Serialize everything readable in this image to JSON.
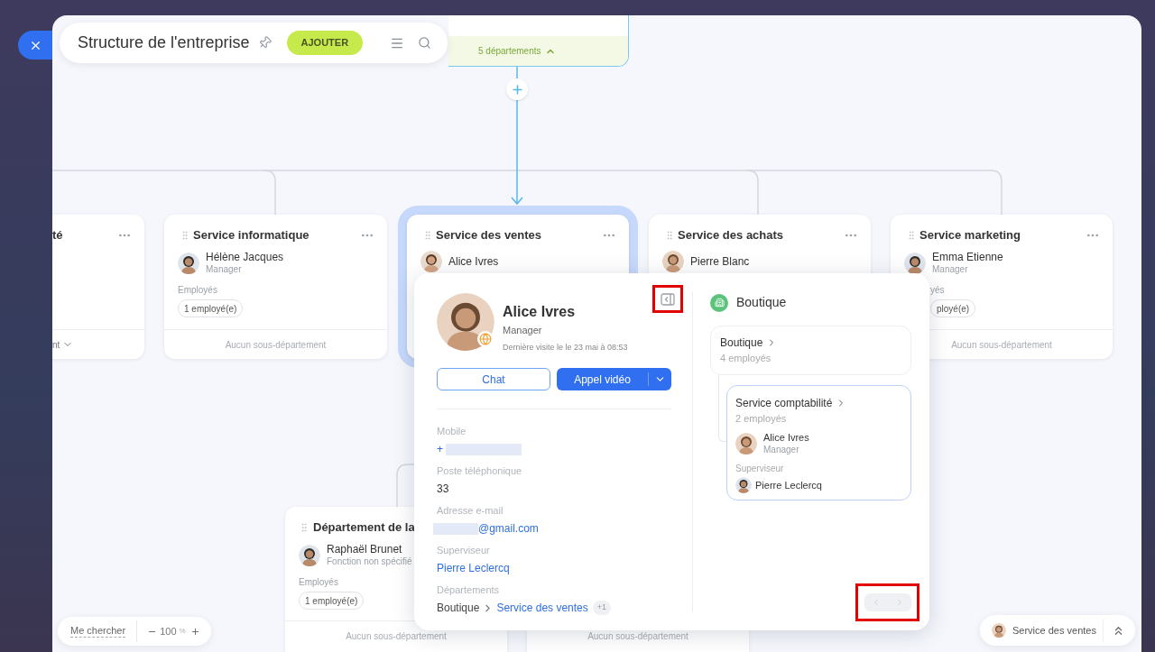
{
  "header": {
    "title": "Structure de l'entreprise",
    "add_button": "AJOUTER"
  },
  "root_node": {
    "footer": "5 départements",
    "expanded": true
  },
  "departments": [
    {
      "kind": "cut_left",
      "title": "té",
      "footer": "nt",
      "expanded": false,
      "selected": false
    },
    {
      "kind": "full",
      "title": "Service informatique",
      "head": {
        "name": "Hélène Jacques",
        "role": "Manager"
      },
      "employees_label": "Employés",
      "employees": "1 employé(e)",
      "footer": "Aucun sous-département",
      "selected": false
    },
    {
      "kind": "covered",
      "title": "Service des ventes",
      "head": {
        "name": "Alice Ivres"
      },
      "selected": true
    },
    {
      "kind": "covered",
      "title": "Service des achats",
      "head": {
        "name": "Pierre Blanc"
      },
      "selected": false
    },
    {
      "kind": "cut_right",
      "title": "Service marketing",
      "head": {
        "name": "Emma Etienne",
        "role": "Manager"
      },
      "employees_label": "yés",
      "employees": "ployé(e)",
      "footer": "Aucun sous-département",
      "selected": false
    }
  ],
  "sub_departments": [
    {
      "title": "Département de la",
      "head": {
        "name": "Raphaël Brunet",
        "role": "Fonction non spécifié"
      },
      "employees_label": "Employés",
      "employees": "1 employé(e)",
      "footer": "Aucun sous-département"
    },
    {
      "footer": "Aucun sous-département"
    }
  ],
  "profile": {
    "name": "Alice Ivres",
    "role": "Manager",
    "last_seen": "Dernière visite le le 23 mai à 08:53",
    "chat": "Chat",
    "video": "Appel vidéo",
    "fields": [
      {
        "kind": "phone",
        "label": "Mobile",
        "value": "+"
      },
      {
        "kind": "text",
        "label": "Poste téléphonique",
        "value": "33"
      },
      {
        "kind": "email",
        "label": "Adresse e-mail",
        "value": "@gmail.com"
      },
      {
        "kind": "link",
        "label": "Superviseur",
        "value": "Pierre Leclercq"
      },
      {
        "kind": "path",
        "label": "Départements",
        "parent": "Boutique",
        "value": "Service des ventes",
        "extra": "+1"
      }
    ],
    "structure": {
      "title": "Boutique",
      "parent": {
        "name": "Boutique",
        "count": "4 employés"
      },
      "current": {
        "name": "Service comptabilité",
        "count": "2 employés",
        "head": {
          "name": "Alice Ivres",
          "role": "Manager"
        },
        "supervisor_label": "Superviseur",
        "supervisor": "Pierre Leclercq"
      }
    },
    "pager": {
      "disabled": true
    }
  },
  "zoom_bar": {
    "find_me": "Me chercher",
    "zoom": "100",
    "unit": "%"
  },
  "current_department": {
    "name": "Service des ventes"
  }
}
